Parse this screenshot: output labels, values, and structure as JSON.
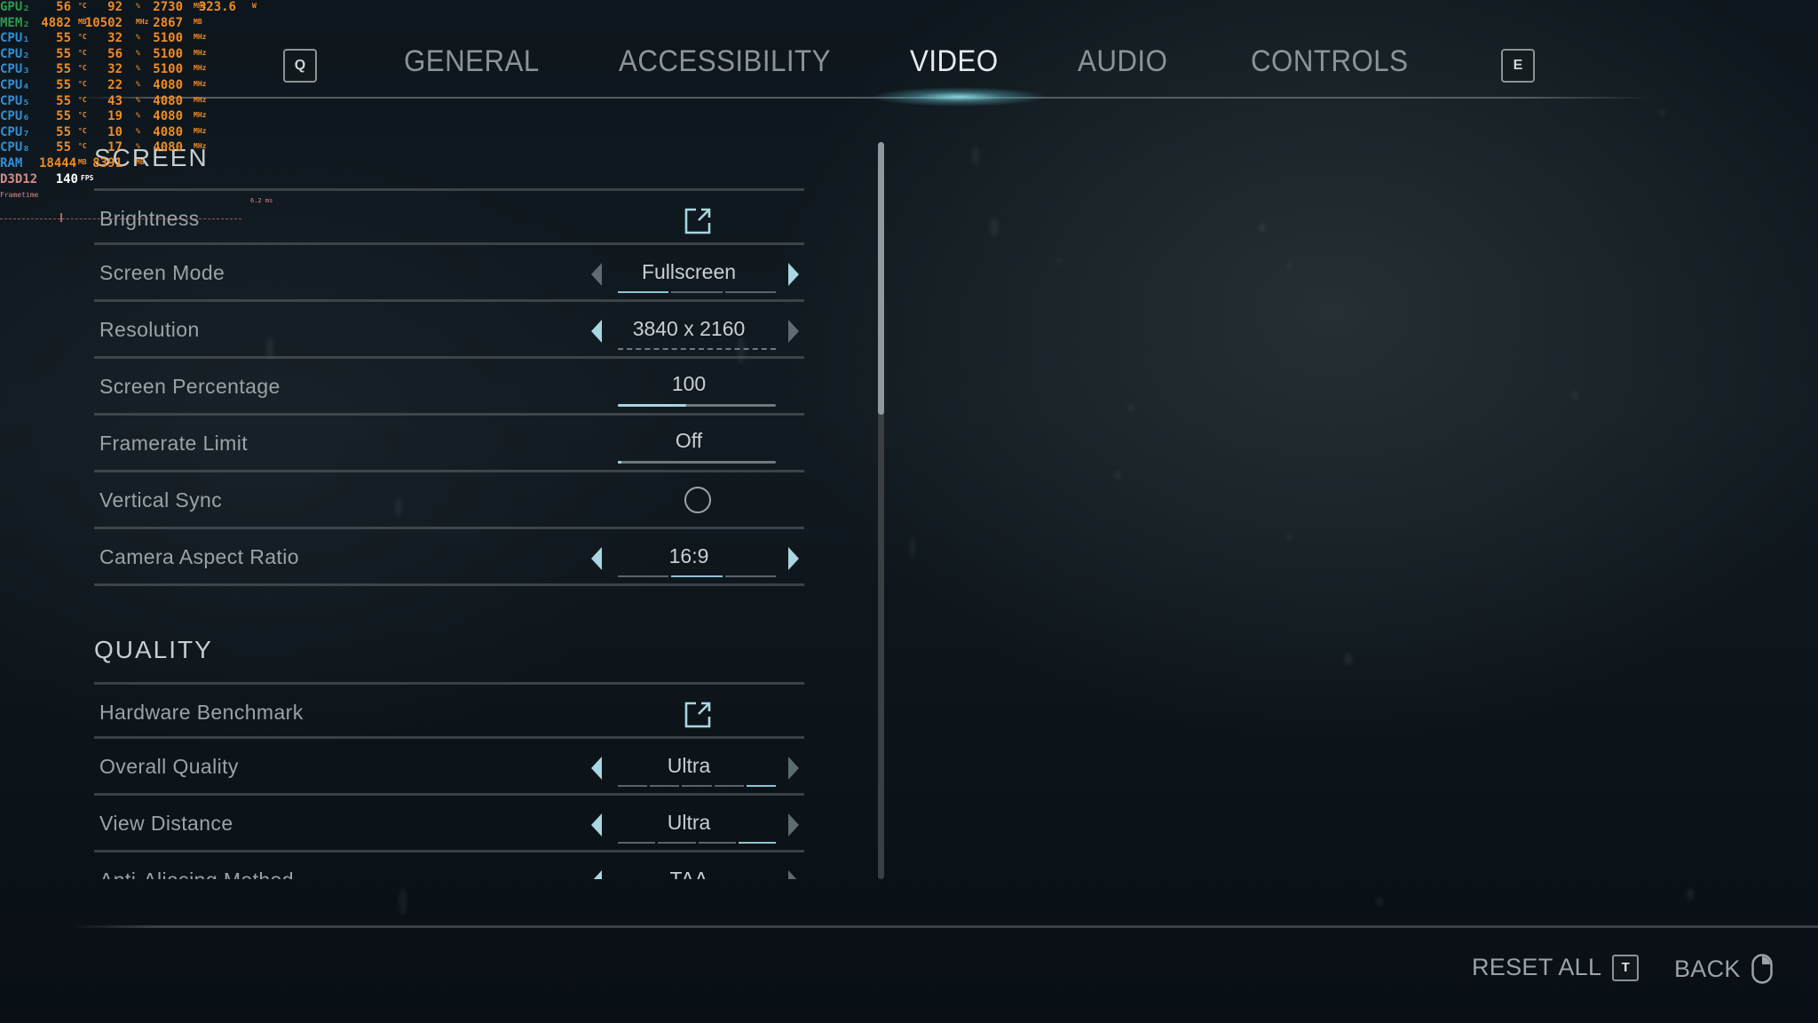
{
  "hud": {
    "rows": [
      {
        "label": "GPU₂",
        "label_type": "gpu",
        "c1": "56",
        "u1": "°C",
        "c2": "92",
        "u2": "%",
        "c3": "2730",
        "u3": "MHz",
        "c4": "323.6",
        "u4": "W"
      },
      {
        "label": "MEM₂",
        "label_type": "gpu",
        "c1": "4882",
        "u1": "MB",
        "c2": "10502",
        "u2": "MHz",
        "c3": "2867",
        "u3": "MB"
      },
      {
        "label": "CPU₁",
        "label_type": "cpu",
        "c1": "55",
        "u1": "°C",
        "c2": "32",
        "u2": "%",
        "c3": "5100",
        "u3": "MHz"
      },
      {
        "label": "CPU₂",
        "label_type": "cpu",
        "c1": "55",
        "u1": "°C",
        "c2": "56",
        "u2": "%",
        "c3": "5100",
        "u3": "MHz"
      },
      {
        "label": "CPU₃",
        "label_type": "cpu",
        "c1": "55",
        "u1": "°C",
        "c2": "32",
        "u2": "%",
        "c3": "5100",
        "u3": "MHz"
      },
      {
        "label": "CPU₄",
        "label_type": "cpu",
        "c1": "55",
        "u1": "°C",
        "c2": "22",
        "u2": "%",
        "c3": "4080",
        "u3": "MHz"
      },
      {
        "label": "CPU₅",
        "label_type": "cpu",
        "c1": "55",
        "u1": "°C",
        "c2": "43",
        "u2": "%",
        "c3": "4080",
        "u3": "MHz"
      },
      {
        "label": "CPU₆",
        "label_type": "cpu",
        "c1": "55",
        "u1": "°C",
        "c2": "19",
        "u2": "%",
        "c3": "4080",
        "u3": "MHz"
      },
      {
        "label": "CPU₇",
        "label_type": "cpu",
        "c1": "55",
        "u1": "°C",
        "c2": "10",
        "u2": "%",
        "c3": "4080",
        "u3": "MHz"
      },
      {
        "label": "CPU₈",
        "label_type": "cpu",
        "c1": "55",
        "u1": "°C",
        "c2": "17",
        "u2": "%",
        "c3": "4080",
        "u3": "MHz"
      },
      {
        "label": "RAM",
        "label_type": "cpu",
        "c1": "18444",
        "u1": "MB",
        "c2": "8391",
        "u2": "MB"
      }
    ],
    "api": {
      "label": "D3D12",
      "fps": "140",
      "fps_unit": "FPS"
    },
    "frametime_label": "Frametime",
    "frametime_ms": "6.2 ms"
  },
  "tabs": {
    "prev_key": "Q",
    "next_key": "E",
    "items": [
      {
        "label": "GENERAL",
        "active": false
      },
      {
        "label": "ACCESSIBILITY",
        "active": false
      },
      {
        "label": "VIDEO",
        "active": true
      },
      {
        "label": "AUDIO",
        "active": false
      },
      {
        "label": "CONTROLS",
        "active": false
      }
    ]
  },
  "sections": {
    "screen": {
      "title": "SCREEN",
      "rows": {
        "brightness": {
          "label": "Brightness",
          "control": "external-link"
        },
        "screen_mode": {
          "label": "Screen Mode",
          "value": "Fullscreen",
          "options_count": 3,
          "selected_index": 0
        },
        "resolution": {
          "label": "Resolution",
          "value": "3840 x 2160"
        },
        "screen_percentage": {
          "label": "Screen Percentage",
          "value": "100",
          "slider_fraction": 0.43
        },
        "framerate_limit": {
          "label": "Framerate Limit",
          "value": "Off",
          "slider_fraction": 0.0
        },
        "vertical_sync": {
          "label": "Vertical Sync",
          "checked": false
        },
        "camera_aspect_ratio": {
          "label": "Camera Aspect Ratio",
          "value": "16:9",
          "options_count": 3,
          "selected_index": 1
        }
      }
    },
    "quality": {
      "title": "QUALITY",
      "rows": {
        "hardware_benchmark": {
          "label": "Hardware Benchmark",
          "control": "external-link"
        },
        "overall_quality": {
          "label": "Overall Quality",
          "value": "Ultra",
          "options_count": 5,
          "selected_index": 4
        },
        "view_distance": {
          "label": "View Distance",
          "value": "Ultra",
          "options_count": 4,
          "selected_index": 3
        },
        "anti_aliasing": {
          "label": "Anti-Aliasing Method",
          "value": "TAA"
        }
      }
    }
  },
  "scrollbar": {
    "visible_fraction": 0.37,
    "position": 0.0
  },
  "footer": {
    "reset_label": "RESET ALL",
    "reset_key": "T",
    "back_label": "BACK"
  },
  "colors": {
    "accent": "#a9d6e0",
    "hud_orange": "#f08a24",
    "hud_green": "#2e9a4e",
    "hud_blue": "#2f8fd6"
  }
}
